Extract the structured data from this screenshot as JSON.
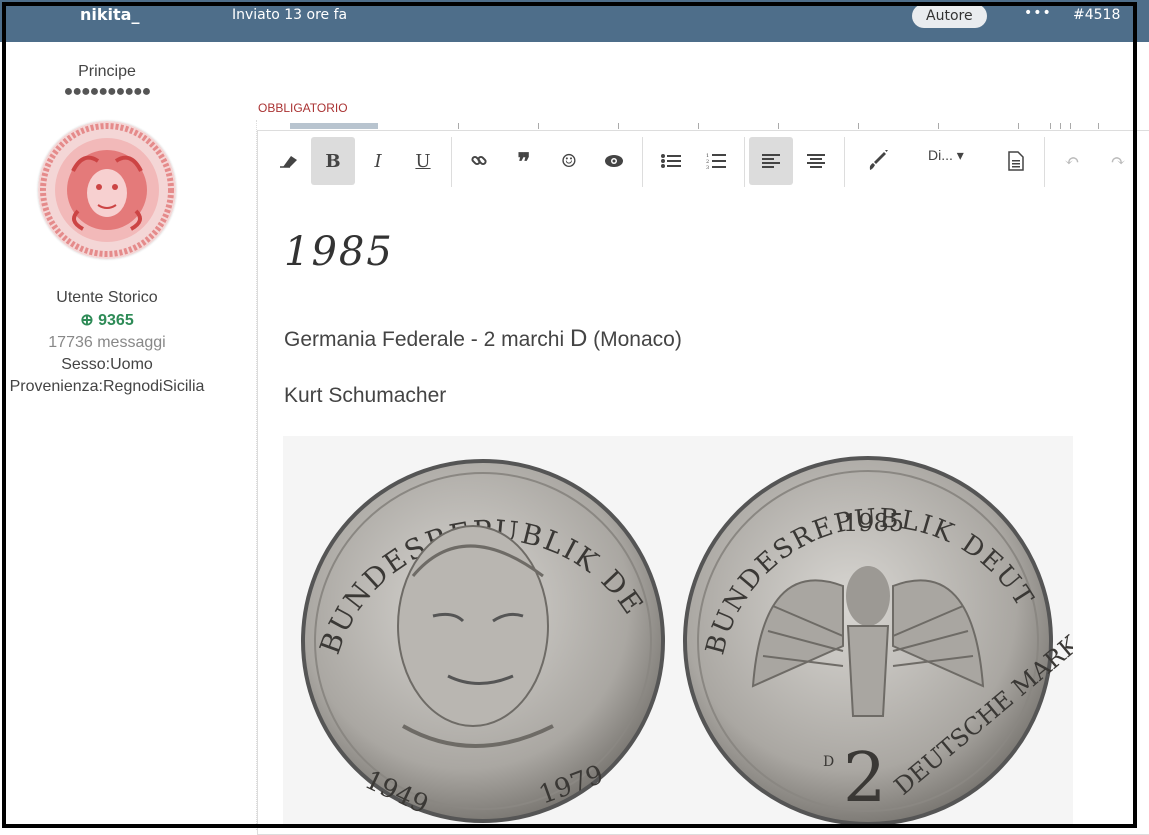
{
  "header": {
    "username": "nikita_",
    "posted": "Inviato 13 ore fa",
    "author_badge": "Autore",
    "more": "•••",
    "post_number": "#4518"
  },
  "profile": {
    "rank": "Principe",
    "pips": "●●●●●●●●●●",
    "group": "Utente Storico",
    "reputation": "9365",
    "messages": "17736 messaggi",
    "sex": "Sesso:Uomo",
    "origin": "Provenienza:RegnodiSicilia"
  },
  "editor": {
    "required_label": "OBBLIGATORIO",
    "format_label": "Di...",
    "toolbar": [
      "eraser-icon",
      "bold",
      "italic",
      "underline",
      "link-icon",
      "quote-icon",
      "emoji-icon",
      "preview-icon",
      "bullet-list-icon",
      "numbered-list-icon",
      "align-left-icon",
      "align-center-icon",
      "brush-icon",
      "format-dropdown",
      "document-icon",
      "undo-icon",
      "redo-icon"
    ]
  },
  "content": {
    "year": "1985",
    "line1_a": "Germania Federale - 2 marchi",
    "line1_b": "D",
    "line1_c": "(Monaco)",
    "line2": "Kurt Schumacher"
  },
  "coins": {
    "obverse_top": "BUNDESREPUBLIK DEUTSCHLAND",
    "obverse_years": "1949 1979",
    "reverse_top": "BUNDESREPUBLIK DEUTSCHLAND",
    "reverse_year": "1985",
    "reverse_bottom": "DEUTSCHE MARK",
    "reverse_value": "2",
    "reverse_mint": "D"
  },
  "colors": {
    "topbar": "#4e6e8a",
    "reputation": "#2e8b57",
    "required": "#aa3333"
  }
}
